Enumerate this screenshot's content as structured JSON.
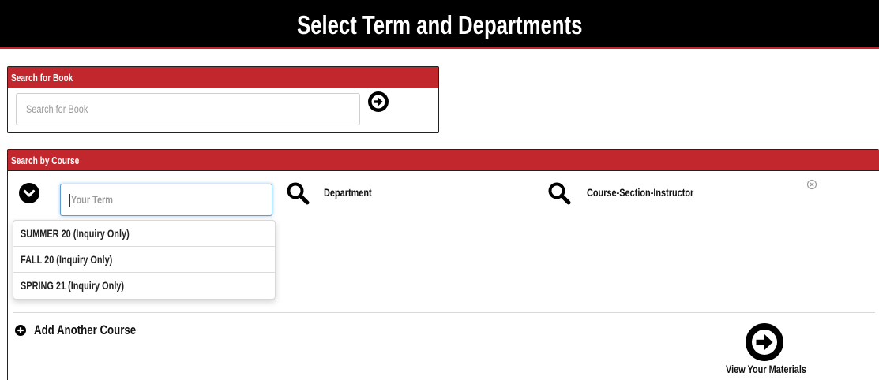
{
  "header": {
    "title": "Select Term and Departments"
  },
  "book_search": {
    "heading": "Search for Book",
    "placeholder": "Search for Book"
  },
  "course_search": {
    "heading": "Search by Course",
    "term_placeholder": "Your Term",
    "department_label": "Department",
    "course_label": "Course-Section-Instructor",
    "term_options": [
      "SUMMER 20 (Inquiry Only)",
      "FALL 20 (Inquiry Only)",
      "SPRING 21 (Inquiry Only)"
    ],
    "add_course_label": "Add Another Course",
    "view_materials_label": "View Your Materials"
  },
  "colors": {
    "header_bg": "#000000",
    "accent_red": "#c1272d",
    "focus_blue": "#5b9dd9"
  },
  "icons": [
    "arrow-circle-right-icon",
    "chevron-down-icon",
    "search-icon",
    "clear-icon",
    "plus-circle-icon"
  ]
}
